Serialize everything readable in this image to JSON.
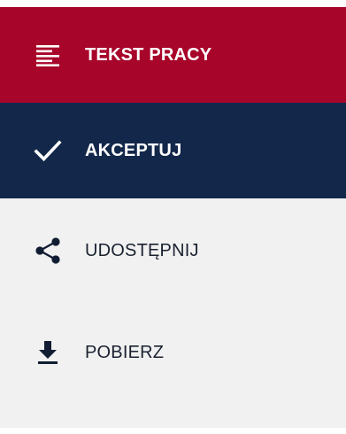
{
  "menu": {
    "items": [
      {
        "label": "TEKST PRACY",
        "icon": "text-lines-icon",
        "active": true,
        "bg": "#a8052a"
      },
      {
        "label": "AKCEPTUJ",
        "icon": "checkmark-icon",
        "bg": "#13274a"
      },
      {
        "label": "UDOSTĘPNIJ",
        "icon": "share-icon"
      },
      {
        "label": "POBIERZ",
        "icon": "download-icon"
      }
    ]
  },
  "colors": {
    "primary_red": "#a8052a",
    "dark_navy": "#13274a",
    "panel_bg": "#f1f1f1",
    "text_dark": "#1a2230"
  }
}
